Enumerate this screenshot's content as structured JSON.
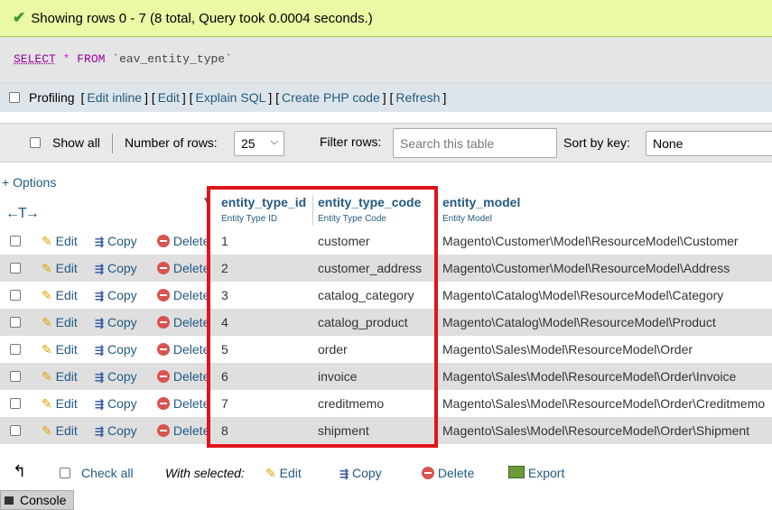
{
  "success": {
    "message": "Showing rows 0 - 7 (8 total, Query took 0.0004 seconds.)"
  },
  "sql": {
    "select": "SELECT",
    "star": "*",
    "from": "FROM",
    "table": "`eav_entity_type`"
  },
  "profiling": {
    "label": "Profiling",
    "links": [
      "Edit inline",
      "Edit",
      "Explain SQL",
      "Create PHP code",
      "Refresh"
    ]
  },
  "nav": {
    "show_all": "Show all",
    "num_rows_label": "Number of rows:",
    "num_rows_value": "25",
    "filter_label": "Filter rows:",
    "filter_placeholder": "Search this table",
    "sort_label": "Sort by key:",
    "sort_value": "None"
  },
  "options_link": "+ Options",
  "columns": [
    {
      "name": "entity_type_id",
      "comment": "Entity Type ID"
    },
    {
      "name": "entity_type_code",
      "comment": "Entity Type Code"
    },
    {
      "name": "entity_model",
      "comment": "Entity Model"
    }
  ],
  "row_actions": {
    "edit": "Edit",
    "copy": "Copy",
    "delete": "Delete"
  },
  "rows": [
    {
      "id": "1",
      "code": "customer",
      "model": "Magento\\Customer\\Model\\ResourceModel\\Customer"
    },
    {
      "id": "2",
      "code": "customer_address",
      "model": "Magento\\Customer\\Model\\ResourceModel\\Address"
    },
    {
      "id": "3",
      "code": "catalog_category",
      "model": "Magento\\Catalog\\Model\\ResourceModel\\Category"
    },
    {
      "id": "4",
      "code": "catalog_product",
      "model": "Magento\\Catalog\\Model\\ResourceModel\\Product"
    },
    {
      "id": "5",
      "code": "order",
      "model": "Magento\\Sales\\Model\\ResourceModel\\Order"
    },
    {
      "id": "6",
      "code": "invoice",
      "model": "Magento\\Sales\\Model\\ResourceModel\\Order\\Invoice"
    },
    {
      "id": "7",
      "code": "creditmemo",
      "model": "Magento\\Sales\\Model\\ResourceModel\\Order\\Creditmemo"
    },
    {
      "id": "8",
      "code": "shipment",
      "model": "Magento\\Sales\\Model\\ResourceModel\\Order\\Shipment"
    }
  ],
  "bulk": {
    "check_all": "Check all",
    "with_selected": "With selected:",
    "edit": "Edit",
    "copy": "Copy",
    "delete": "Delete",
    "export": "Export"
  },
  "console": "Console"
}
